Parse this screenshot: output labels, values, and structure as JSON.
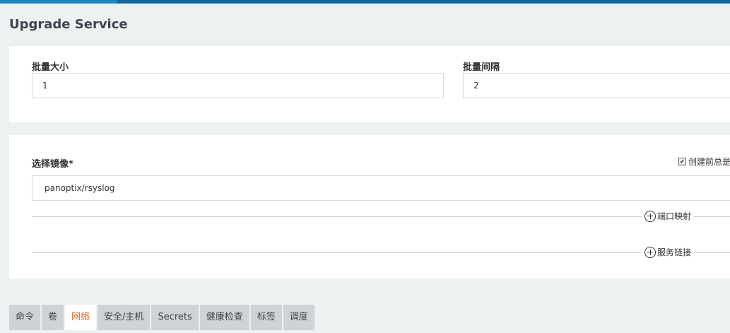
{
  "page": {
    "title": "Upgrade Service"
  },
  "batch": {
    "size_label": "批量大小",
    "size_value": "1",
    "interval_label": "批量间隔",
    "interval_value": "2"
  },
  "image": {
    "label": "选择镜像*",
    "value": "panoptix/rsyslog",
    "checkbox_label": "创建前总是",
    "checkbox_checked": true
  },
  "actions": {
    "port_mapping": "端口映射",
    "service_link": "服务链接"
  },
  "tabs": [
    {
      "label": "命令"
    },
    {
      "label": "卷"
    },
    {
      "label": "网络"
    },
    {
      "label": "安全/主机"
    },
    {
      "label": "Secrets"
    },
    {
      "label": "健康检查"
    },
    {
      "label": "标签"
    },
    {
      "label": "调度"
    }
  ],
  "active_tab": 2,
  "colors": {
    "top_bar": "#0f6a9e",
    "active_tab_text": "#e06b1f"
  }
}
